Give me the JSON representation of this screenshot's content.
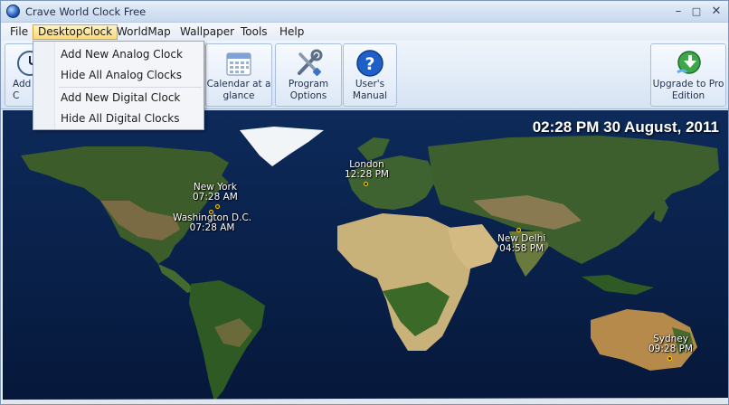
{
  "window": {
    "title": "Crave World Clock Free"
  },
  "menu": {
    "file": "File",
    "desktop_clock": "DesktopClock",
    "world_map": "WorldMap",
    "wallpaper": "Wallpaper",
    "tools": "Tools",
    "help": "Help"
  },
  "dropdown": {
    "items": [
      "Add New Analog Clock",
      "Hide All Analog Clocks",
      "Add New Digital Clock",
      "Hide All Digital Clocks"
    ]
  },
  "toolbar": {
    "add_analog": "Add\nC",
    "calendar": "Calendar at a\nglance",
    "options": "Program\nOptions",
    "manual": "User's\nManual",
    "upgrade": "Upgrade to Pro\nEdition"
  },
  "clock": {
    "display": "02:28 PM 30 August, 2011"
  },
  "cities": [
    {
      "name": "London",
      "time": "12:28 PM"
    },
    {
      "name": "New York",
      "time": "07:28 AM"
    },
    {
      "name": "Washington D.C.",
      "time": "07:28 AM"
    },
    {
      "name": "New Delhi",
      "time": "04:58 PM"
    },
    {
      "name": "Sydney",
      "time": "09:28 PM"
    }
  ],
  "icons": {
    "app": "globe-icon",
    "calendar": "calendar-icon",
    "options": "tools-icon",
    "manual": "help-icon",
    "upgrade": "upgrade-icon",
    "add_analog": "analog-clock-icon"
  },
  "colors": {
    "ocean": "#071a3e",
    "accent": "#d6a63d"
  }
}
